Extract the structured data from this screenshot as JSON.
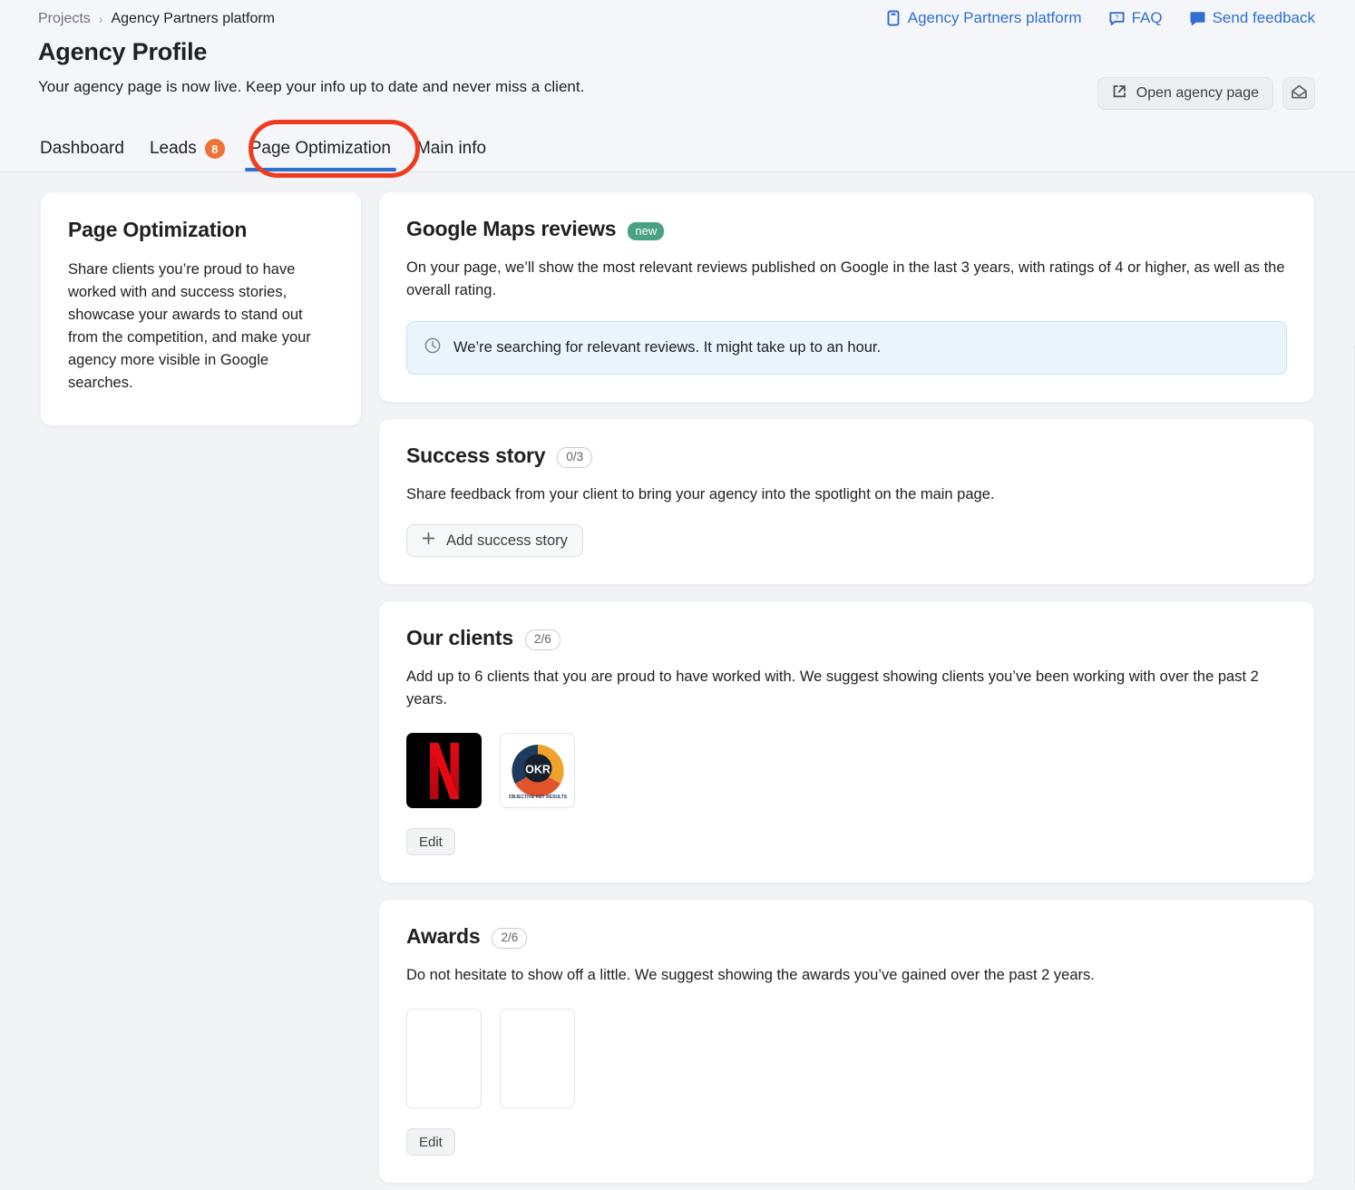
{
  "header": {
    "breadcrumb": {
      "root": "Projects",
      "separator": "›",
      "current": "Agency Partners platform"
    },
    "title": "Agency Profile",
    "subtitle": "Your agency page is now live. Keep your info up to date and never miss a client.",
    "links": [
      {
        "label": "Agency Partners platform",
        "icon": "book-icon"
      },
      {
        "label": "FAQ",
        "icon": "question-bubble-icon"
      },
      {
        "label": "Send feedback",
        "icon": "feedback-bubble-icon"
      }
    ],
    "open_page_button": "Open agency page",
    "mail_button_icon": "envelope-icon",
    "accent_link_color": "#2f6fd0"
  },
  "tabs": [
    {
      "label": "Dashboard",
      "active": false,
      "badge": null
    },
    {
      "label": "Leads",
      "active": false,
      "badge": "8"
    },
    {
      "label": "Page Optimization",
      "active": true,
      "badge": null
    },
    {
      "label": "Main info",
      "active": false,
      "badge": null
    }
  ],
  "annotation": {
    "shape": "ellipse",
    "color": "#ef3b20",
    "target": "Page Optimization"
  },
  "sidebar": {
    "title": "Page Optimization",
    "text": "Share clients you’re proud to have worked with and success stories, showcase your awards to stand out from the competition, and make your agency more visible in Google searches."
  },
  "sections": {
    "google_reviews": {
      "title": "Google Maps reviews",
      "badge": "new",
      "badge_color": "#4aa184",
      "description": "On your page, we’ll show the most relevant reviews published on Google in the last 3 years, with ratings of 4 or higher, as well as the overall rating.",
      "callout": {
        "icon": "clock-icon",
        "text": "We’re searching for relevant reviews. It might take up to an hour.",
        "background": "#e9f4fd"
      }
    },
    "success_story": {
      "title": "Success story",
      "counter": "0/3",
      "description": "Share feedback from your client to bring your agency into the spotlight on the main page.",
      "add_button": "Add success story"
    },
    "our_clients": {
      "title": "Our clients",
      "counter": "2/6",
      "description": "Add up to 6 clients that you are proud to have worked with. We suggest showing clients you’ve been working with over the past 2 years.",
      "logos": [
        {
          "name": "netflix-logo",
          "letter": "N"
        },
        {
          "name": "okr-logo",
          "text": "OKR",
          "caption": "OBJECTIVE KEY RESULTS"
        }
      ],
      "edit_button": "Edit"
    },
    "awards": {
      "title": "Awards",
      "counter": "2/6",
      "description": "Do not hesitate to show off a little. We suggest showing the awards you’ve gained over the past 2 years.",
      "items": [
        {
          "name": "award-tile-1"
        },
        {
          "name": "award-tile-2"
        }
      ],
      "edit_button": "Edit"
    }
  }
}
